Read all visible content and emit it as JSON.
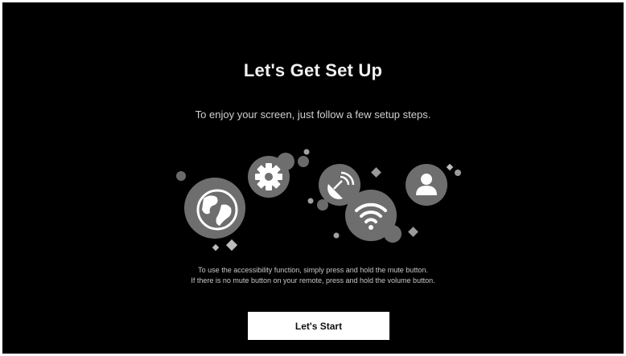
{
  "setup": {
    "title": "Let's Get Set Up",
    "subtitle": "To enjoy your screen, just follow a few setup steps.",
    "accessibility_note_line1": "To use the accessibility function, simply press and hold the mute button.",
    "accessibility_note_line2": "If there is no mute button on your remote, press and hold the volume button.",
    "start_button_label": "Let's Start"
  },
  "illustration_icons": [
    "globe-icon",
    "gear-icon",
    "satellite-dish-icon",
    "wifi-icon",
    "user-icon"
  ],
  "colors": {
    "background": "#000000",
    "circle": "#6e6e6e",
    "icon_fill": "#ffffff",
    "decor": "#8a8a8a",
    "button": "#ffffff",
    "button_text": "#111111"
  }
}
